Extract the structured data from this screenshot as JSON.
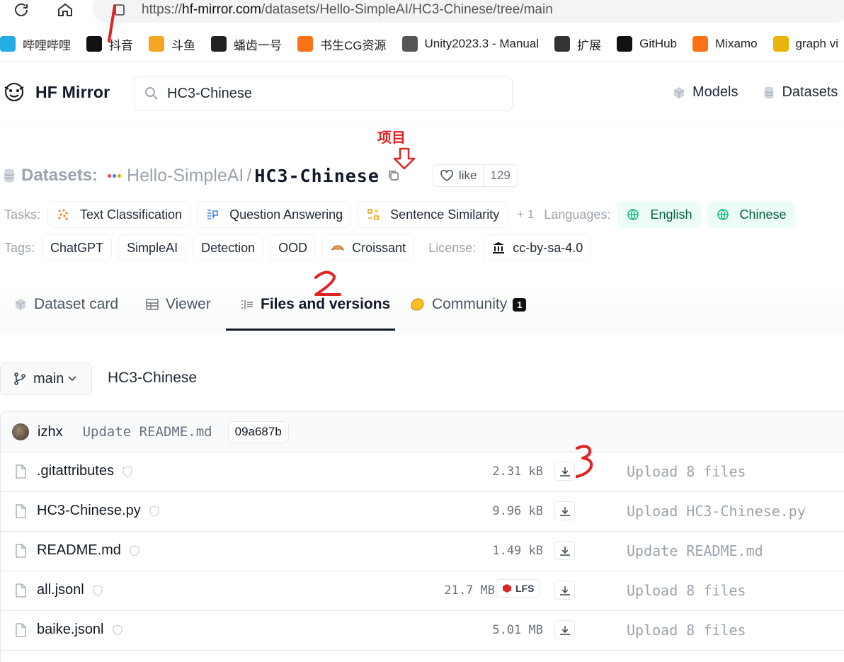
{
  "browser": {
    "url_prefix": "https://",
    "url_domain": "hf-mirror.com",
    "url_path": "/datasets/Hello-SimpleAI/HC3-Chinese/tree/main",
    "bookmarks": [
      {
        "label": "哔哩哔哩",
        "icon": "bilibili-icon",
        "color": "#23ade5"
      },
      {
        "label": "抖音",
        "icon": "douyin-icon",
        "color": "#111111"
      },
      {
        "label": "斗鱼",
        "icon": "douyu-icon",
        "color": "#f5a623"
      },
      {
        "label": "蟠齿一号",
        "icon": "gear-game-icon",
        "color": "#222222"
      },
      {
        "label": "书生CG资源",
        "icon": "plus-orange-icon",
        "color": "#f97316"
      },
      {
        "label": "Unity2023.3 - Manual",
        "icon": "unity-icon",
        "color": "#555555"
      },
      {
        "label": "扩展",
        "icon": "extension-icon",
        "color": "#333333"
      },
      {
        "label": "GitHub",
        "icon": "github-icon",
        "color": "#111111"
      },
      {
        "label": "Mixamo",
        "icon": "mixamo-icon",
        "color": "#f97316"
      },
      {
        "label": "graph vi",
        "icon": "folder-icon",
        "color": "#eab308"
      }
    ]
  },
  "header": {
    "brand": "HF Mirror",
    "search_value": "HC3-Chinese",
    "nav": [
      "Models",
      "Datasets"
    ]
  },
  "repo": {
    "kind": "Datasets:",
    "org": "Hello-SimpleAI",
    "slash": "/",
    "name": "HC3-Chinese",
    "like_label": "like",
    "like_count": "129",
    "annotation_project": "项目"
  },
  "tasks": {
    "label": "Tasks:",
    "items": [
      "Text Classification",
      "Question Answering",
      "Sentence Similarity"
    ],
    "more": "+ 1"
  },
  "languages": {
    "label": "Languages:",
    "items": [
      "English",
      "Chinese"
    ]
  },
  "tags": {
    "label": "Tags:",
    "items": [
      "ChatGPT",
      "SimpleAI",
      "Detection",
      "OOD",
      "Croissant"
    ]
  },
  "license": {
    "label": "License:",
    "value": "cc-by-sa-4.0"
  },
  "tabs": [
    {
      "label": "Dataset card",
      "active": false
    },
    {
      "label": "Viewer",
      "active": false
    },
    {
      "label": "Files and versions",
      "active": true
    },
    {
      "label": "Community",
      "active": false,
      "badge": "1"
    }
  ],
  "branch": {
    "name": "main",
    "path": "HC3-Chinese"
  },
  "last_commit": {
    "user": "izhx",
    "message": "Update README.md",
    "sha": "09a687b"
  },
  "files": [
    {
      "name": ".gitattributes",
      "size": "2.31 kB",
      "lfs": false,
      "commit": "Upload 8 files"
    },
    {
      "name": "HC3-Chinese.py",
      "size": "9.96 kB",
      "lfs": false,
      "commit": "Upload HC3-Chinese.py"
    },
    {
      "name": "README.md",
      "size": "1.49 kB",
      "lfs": false,
      "commit": "Update README.md"
    },
    {
      "name": "all.jsonl",
      "size": "21.7 MB",
      "lfs": true,
      "commit": "Upload 8 files"
    },
    {
      "name": "baike.jsonl",
      "size": "5.01 MB",
      "lfs": false,
      "commit": "Upload 8 files"
    }
  ],
  "lfs_label": "LFS",
  "colors": {
    "annotation": "#e02424",
    "lang_bg": "#ecfdf5"
  }
}
